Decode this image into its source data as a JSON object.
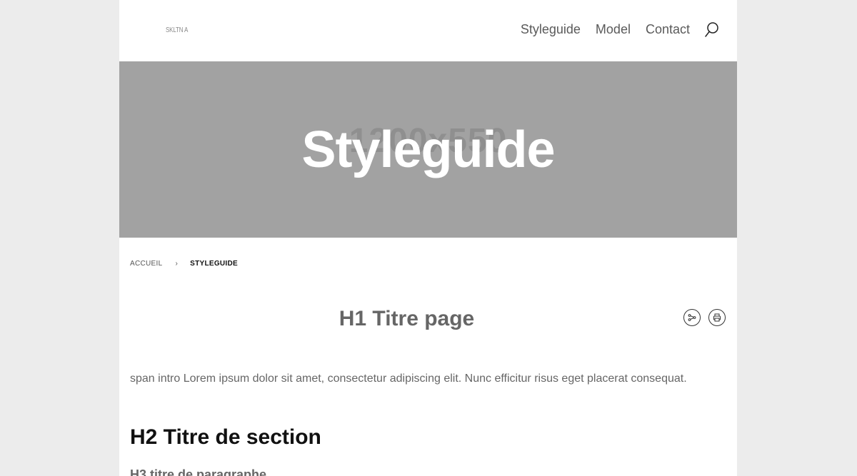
{
  "header": {
    "logo_text": "SKLTN A",
    "nav": [
      {
        "label": "Styleguide"
      },
      {
        "label": "Model"
      },
      {
        "label": "Contact"
      }
    ]
  },
  "hero": {
    "dimensions_text": "1200x550",
    "title": "Styleguide"
  },
  "breadcrumb": {
    "home": "ACCUEIL",
    "separator": "›",
    "current": "STYLEGUIDE"
  },
  "content": {
    "h1": "H1 Titre page",
    "intro": "span intro Lorem ipsum dolor sit amet, consectetur adipiscing elit. Nunc efficitur risus eget placerat consequat.",
    "h2": "H2 Titre de section",
    "h3": "H3 titre de paragraphe"
  },
  "icons": {
    "search": "search-icon",
    "share": "share-icon",
    "print": "print-icon"
  }
}
